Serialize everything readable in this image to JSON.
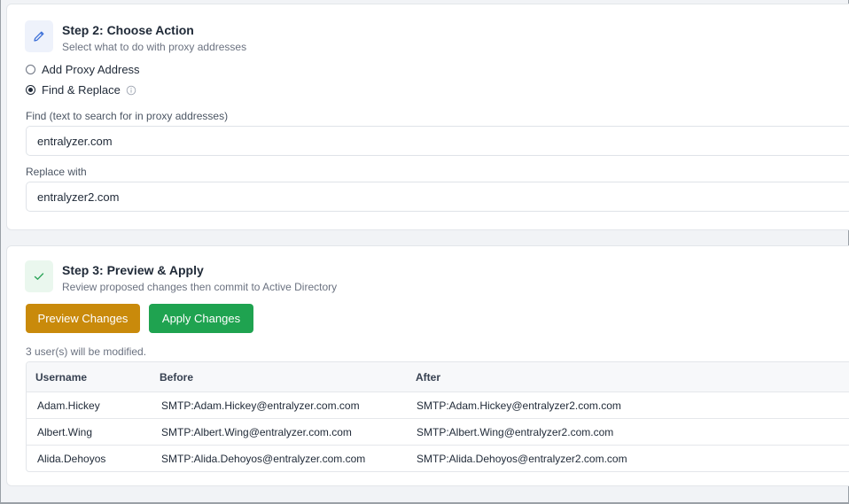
{
  "step2": {
    "icon": "pencil-icon",
    "title": "Step 2: Choose Action",
    "subtitle": "Select what to do with proxy addresses",
    "options": [
      {
        "label": "Add Proxy Address",
        "checked": false
      },
      {
        "label": "Find & Replace",
        "checked": true,
        "info_icon": "info-icon"
      }
    ],
    "find_label": "Find (text to search for in proxy addresses)",
    "find_value": "entralyzer.com",
    "replace_label": "Replace with",
    "replace_value": "entralyzer2.com"
  },
  "step3": {
    "icon": "check-icon",
    "title": "Step 3: Preview & Apply",
    "subtitle": "Review proposed changes then commit to Active Directory",
    "preview_button": "Preview Changes",
    "apply_button": "Apply Changes",
    "modified_count": "3 user(s) will be modified.",
    "table": {
      "headers": [
        "Username",
        "Before",
        "After"
      ],
      "rows": [
        [
          "Adam.Hickey",
          "SMTP:Adam.Hickey@entralyzer.com.com",
          "SMTP:Adam.Hickey@entralyzer2.com.com"
        ],
        [
          "Albert.Wing",
          "SMTP:Albert.Wing@entralyzer.com.com",
          "SMTP:Albert.Wing@entralyzer2.com.com"
        ],
        [
          "Alida.Dehoyos",
          "SMTP:Alida.Dehoyos@entralyzer.com.com",
          "SMTP:Alida.Dehoyos@entralyzer2.com.com"
        ]
      ]
    }
  },
  "colors": {
    "accent_blue": "#3b6fd8",
    "preview_button": "#c98a0b",
    "apply_button": "#1fa350",
    "check_green": "#2ea55a"
  }
}
